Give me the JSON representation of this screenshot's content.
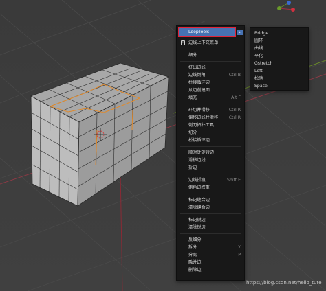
{
  "context_menu": {
    "highlighted": "LoopTools",
    "items": [
      {
        "label": "边线上下文菜单",
        "icon": "info-icon"
      },
      {
        "label": "细分"
      },
      {
        "label": "挤出边线"
      },
      {
        "label": "边线倒角",
        "shortcut": "Ctrl B"
      },
      {
        "label": "桥接循环边"
      },
      {
        "label": "从边创建面"
      },
      {
        "label": "填充",
        "shortcut": "Alt F"
      },
      {
        "label": "环切并滑移",
        "shortcut": "Ctrl R"
      },
      {
        "label": "偏移边线并滑移",
        "shortcut": "Ctrl R"
      },
      {
        "label": "刺刀拓扑工具"
      },
      {
        "label": "切分"
      },
      {
        "label": "桥接循环边"
      },
      {
        "label": "顺时针旋转边"
      },
      {
        "label": "滑移边线"
      },
      {
        "label": "折边"
      },
      {
        "label": "边线折痕",
        "shortcut": "Shift E"
      },
      {
        "label": "倒角边权重"
      },
      {
        "label": "标记缝合边"
      },
      {
        "label": "清除缝合边"
      },
      {
        "label": "标记锐边"
      },
      {
        "label": "清除锐边"
      },
      {
        "label": "反细分"
      },
      {
        "label": "拆分",
        "shortcut": "Y"
      },
      {
        "label": "分离",
        "shortcut": "P"
      },
      {
        "label": "融并边"
      },
      {
        "label": "删除边"
      }
    ]
  },
  "sub_menu": {
    "items": [
      "Bridge",
      "圆环",
      "曲线",
      "平化",
      "Gstretch",
      "Loft",
      "松弛",
      "Space"
    ]
  },
  "watermark": "https://blog.csdn.net/hello_tute",
  "colors": {
    "highlight": "#4772b3",
    "highlight_border": "#e0243a",
    "menu_bg": "#181818",
    "selection_orange": "#e08a2c"
  }
}
